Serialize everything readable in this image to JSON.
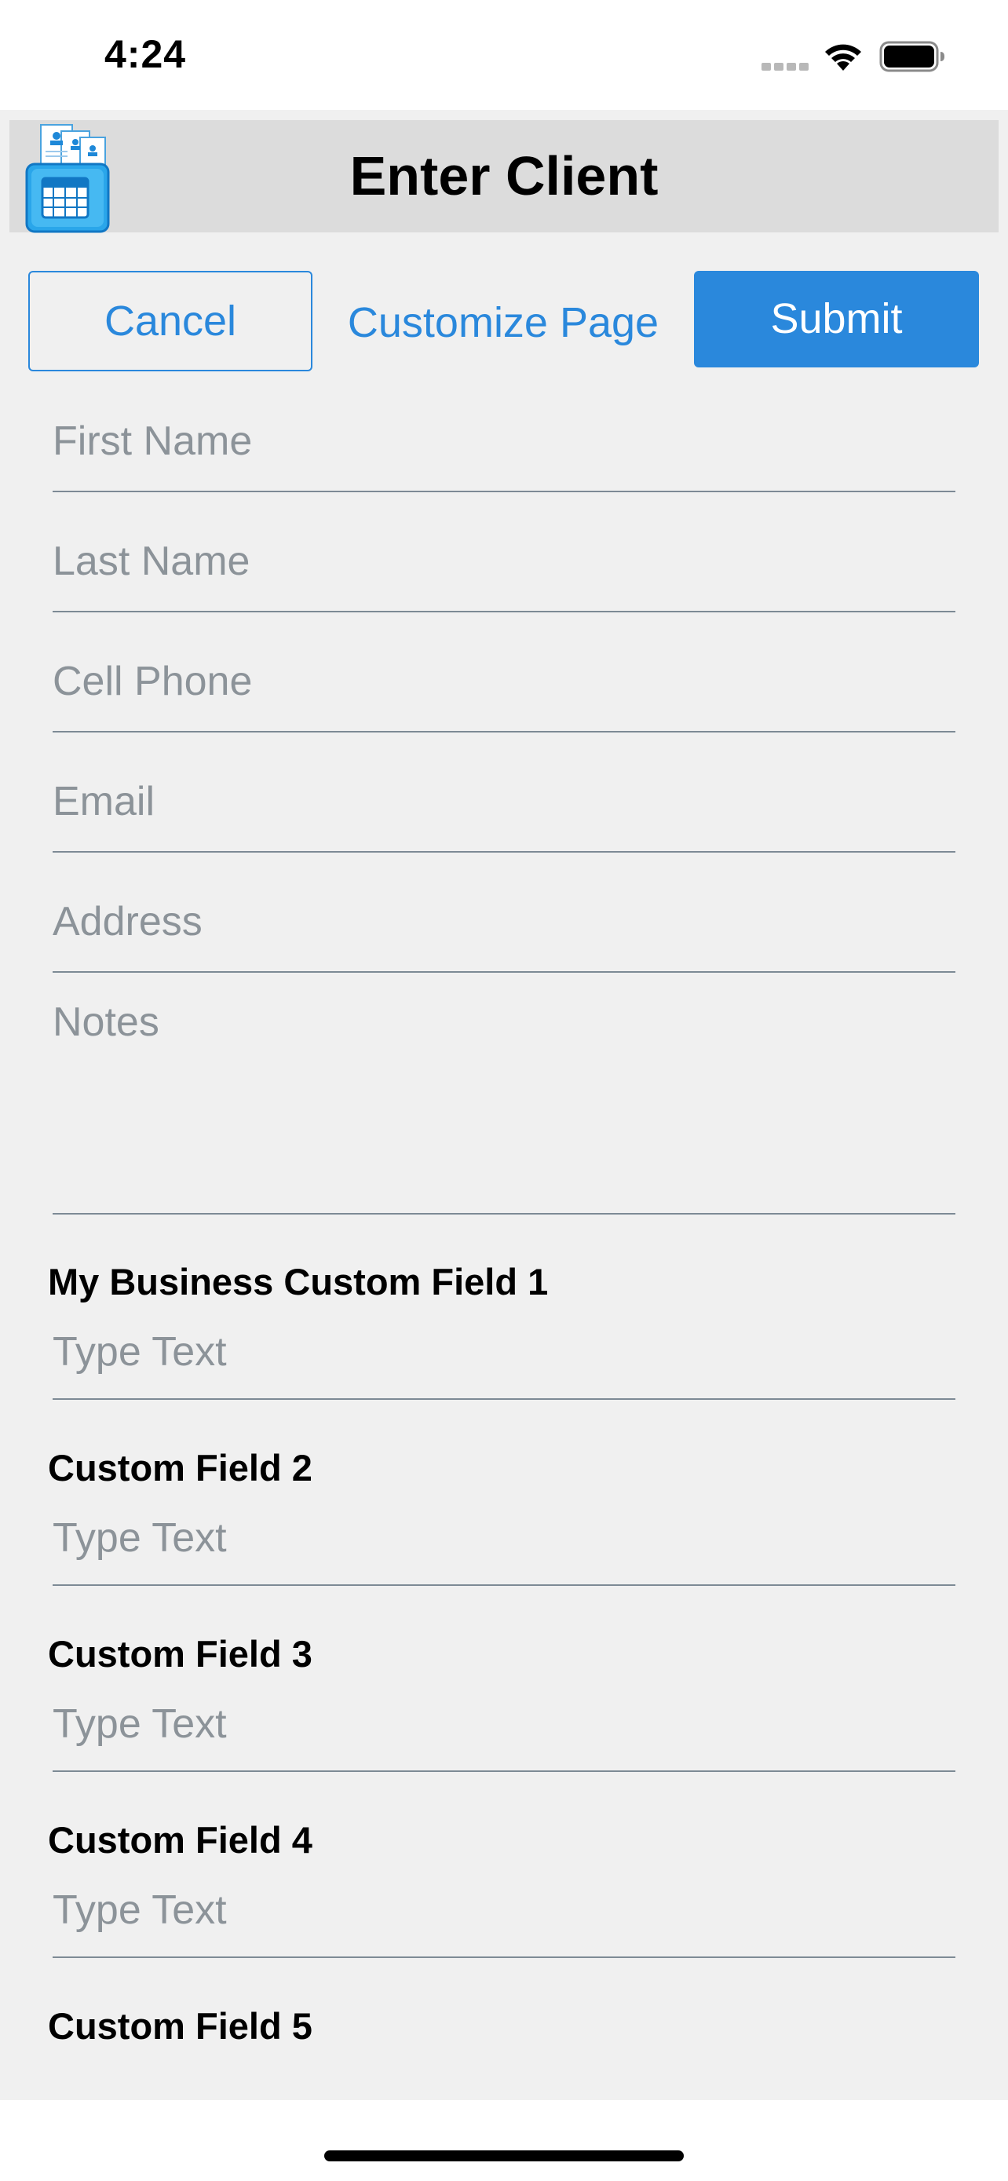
{
  "status_bar": {
    "time": "4:24",
    "icons": [
      "signal-icon",
      "wifi-icon",
      "battery-icon"
    ]
  },
  "header": {
    "title": "Enter Client",
    "logo_icon": "client-files-calendar-icon"
  },
  "toolbar": {
    "cancel_label": "Cancel",
    "customize_label": "Customize Page",
    "submit_label": "Submit"
  },
  "form": {
    "first_name": {
      "placeholder": "First Name",
      "value": ""
    },
    "last_name": {
      "placeholder": "Last Name",
      "value": ""
    },
    "cell_phone": {
      "placeholder": "Cell Phone",
      "value": ""
    },
    "email": {
      "placeholder": "Email",
      "value": ""
    },
    "address": {
      "placeholder": "Address",
      "value": ""
    },
    "notes": {
      "placeholder": "Notes",
      "value": ""
    }
  },
  "custom_fields": [
    {
      "label": "My Business Custom Field 1",
      "placeholder": "Type Text"
    },
    {
      "label": "Custom Field 2",
      "placeholder": "Type Text"
    },
    {
      "label": "Custom Field 3",
      "placeholder": "Type Text"
    },
    {
      "label": "Custom Field 4",
      "placeholder": "Type Text"
    },
    {
      "label": "Custom Field 5",
      "placeholder": ""
    }
  ],
  "colors": {
    "accent": "#2a88dc",
    "background": "#f0f0f0",
    "title_bar": "#dcdcdc",
    "placeholder": "#8c9399",
    "divider": "#7d8a95"
  }
}
